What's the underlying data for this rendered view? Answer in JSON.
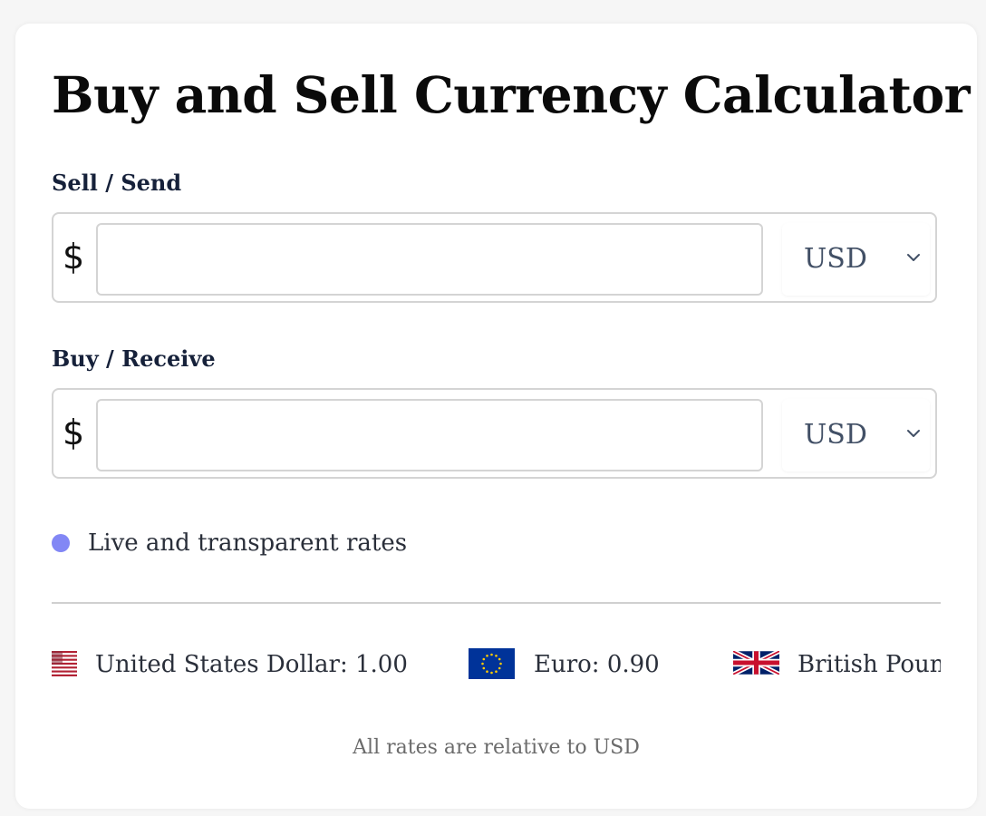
{
  "title": "Buy and Sell Currency Calculator",
  "sell": {
    "label": "Sell / Send",
    "symbol": "$",
    "amount": "",
    "currency": "USD"
  },
  "buy": {
    "label": "Buy / Receive",
    "symbol": "$",
    "amount": "",
    "currency": "USD"
  },
  "live_indicator": {
    "text": "Live and transparent rates",
    "dot_color": "#8287f5"
  },
  "rates": [
    {
      "icon": "us-flag-icon",
      "text": "United States Dollar: 1.00"
    },
    {
      "icon": "eu-flag-icon",
      "text": "Euro: 0.90"
    },
    {
      "icon": "uk-flag-icon",
      "text": "British Pound"
    }
  ],
  "footnote": "All rates are relative to USD",
  "colors": {
    "title": "#0a0a0a",
    "label": "#16213a",
    "select_text": "#425066",
    "border": "#d4d4d4"
  }
}
